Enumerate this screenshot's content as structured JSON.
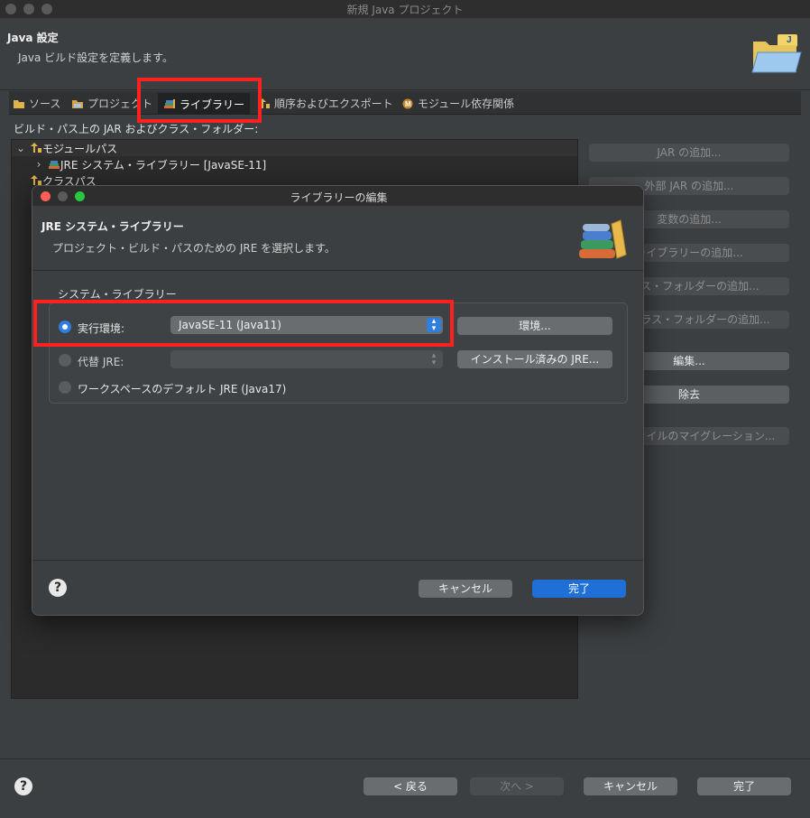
{
  "window": {
    "title": "新規 Java プロジェクト"
  },
  "header": {
    "title": "Java 設定",
    "description": "Java ビルド設定を定義します。"
  },
  "tabs": [
    {
      "label": "ソース",
      "icon": "source-folder-icon"
    },
    {
      "label": "プロジェクト",
      "icon": "project-folder-icon"
    },
    {
      "label": "ライブラリー",
      "icon": "libraries-icon",
      "selected": true
    },
    {
      "label": "順序およびエクスポート",
      "icon": "order-export-icon"
    },
    {
      "label": "モジュール依存関係",
      "icon": "module-icon"
    }
  ],
  "build_path": {
    "label": "ビルド・パス上の JAR およびクラス・フォルダー:",
    "tree": [
      {
        "label": "モジュールパス",
        "expanded": true
      },
      {
        "label": "JRE システム・ライブラリー [JavaSE-11]",
        "expanded": false
      },
      {
        "label": "クラスパス"
      }
    ]
  },
  "side_buttons": [
    {
      "label": "JAR の追加...",
      "enabled": false
    },
    {
      "label": "外部 JAR の追加...",
      "enabled": false
    },
    {
      "label": "変数の追加...",
      "enabled": false
    },
    {
      "label": "ライブラリーの追加...",
      "enabled": false
    },
    {
      "label": "クラス・フォルダーの追加...",
      "enabled": false
    },
    {
      "label": "外部クラス・フォルダーの追加...",
      "enabled": false
    },
    {
      "label": "編集...",
      "enabled": true
    },
    {
      "label": "除去",
      "enabled": true
    },
    {
      "label": "JAR ファイルのマイグレーション...",
      "enabled": false
    }
  ],
  "footer": {
    "help": "?",
    "back": "< 戻る",
    "next": "次へ >",
    "cancel": "キャンセル",
    "finish": "完了"
  },
  "dialog": {
    "title": "ライブラリーの編集",
    "header_title": "JRE システム・ライブラリー",
    "header_desc": "プロジェクト・ビルド・パスのための JRE を選択します。",
    "group_label": "システム・ライブラリー",
    "options": {
      "execution_env": {
        "label": "実行環境:",
        "selected": true,
        "value": "JavaSE-11 (Java11)",
        "button": "環境..."
      },
      "alternate_jre": {
        "label": "代替 JRE:",
        "selected": false,
        "value": "",
        "button": "インストール済みの JRE..."
      },
      "workspace_default": {
        "label": "ワークスペースのデフォルト JRE (Java17)",
        "selected": false
      }
    },
    "help": "?",
    "cancel": "キャンセル",
    "ok": "完了"
  },
  "colors": {
    "accent": "#1f6fd6",
    "highlight_box": "#ff2020",
    "window_bg": "#3c3f41"
  }
}
